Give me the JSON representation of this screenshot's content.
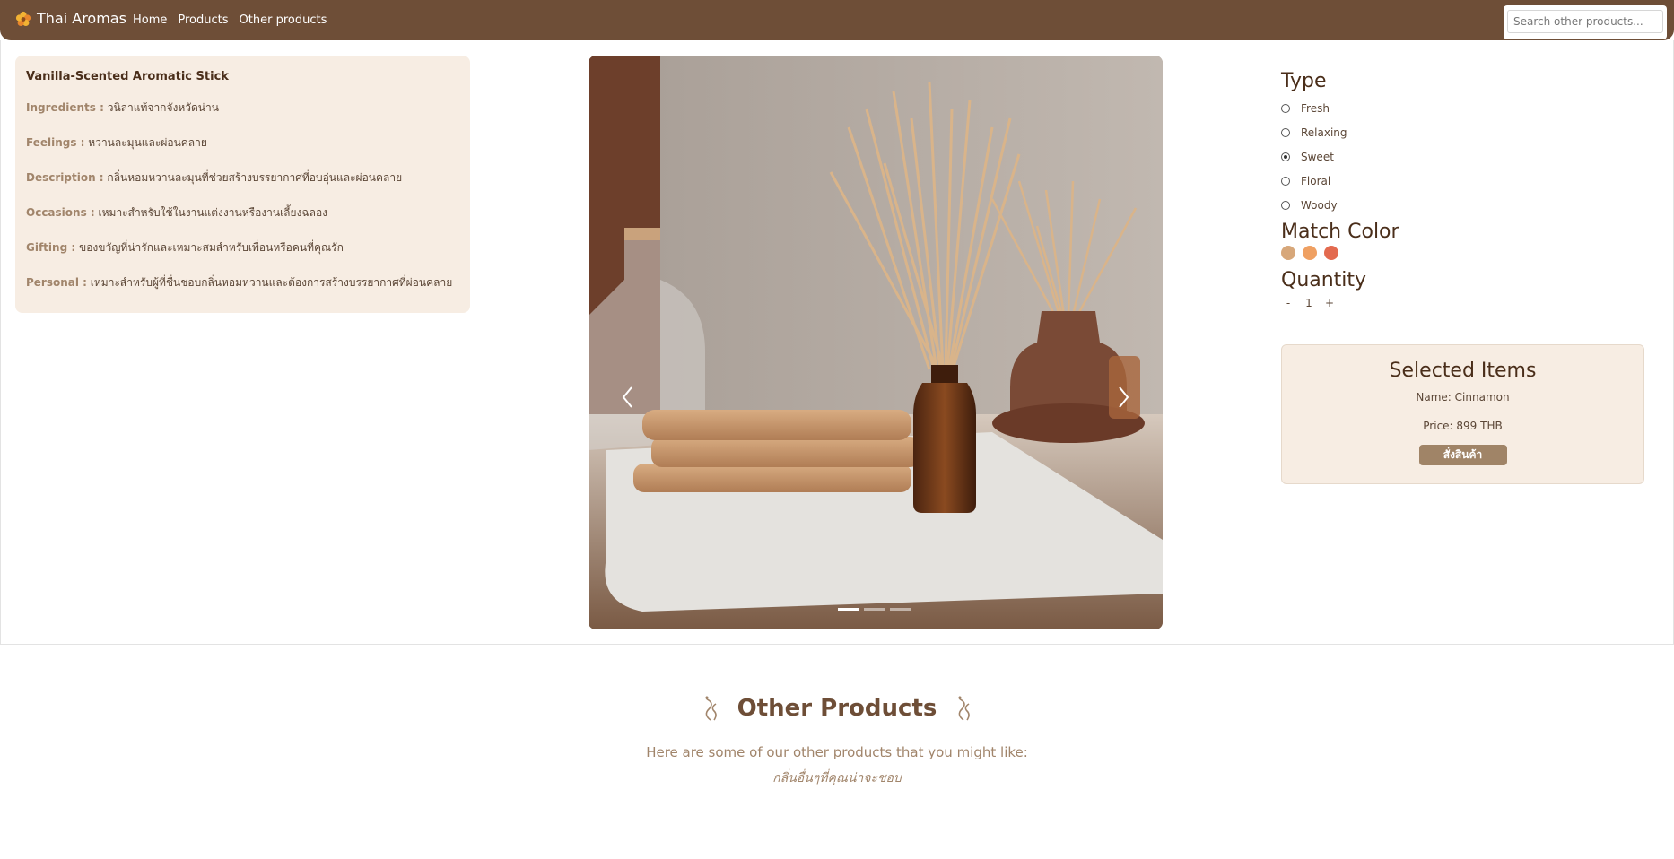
{
  "navbar": {
    "brand": "Thai Aromas",
    "brand_icon": "flower-icon",
    "links": [
      "Home",
      "Products",
      "Other products"
    ],
    "search_placeholder": "Search other products..."
  },
  "product_info": {
    "title": "Vanilla-Scented Aromatic Stick",
    "rows": [
      {
        "key": "Ingredients :",
        "value": "วนิลาแท้จากจังหวัดน่าน"
      },
      {
        "key": "Feelings :",
        "value": "หวานละมุนและผ่อนคลาย"
      },
      {
        "key": "Description :",
        "value": "กลิ่นหอมหวานละมุนที่ช่วยสร้างบรรยากาศที่อบอุ่นและผ่อนคลาย"
      },
      {
        "key": "Occasions :",
        "value": "เหมาะสำหรับใช้ในงานแต่งงานหรืองานเลี้ยงฉลอง"
      },
      {
        "key": "Gifting :",
        "value": "ของขวัญที่น่ารักและเหมาะสมสำหรับเพื่อนหรือคนที่คุณรัก"
      },
      {
        "key": "Personal :",
        "value": "เหมาะสำหรับผู้ที่ชื่นชอบกลิ่นหอมหวานและต้องการสร้างบรรยากาศที่ผ่อนคลาย"
      }
    ]
  },
  "carousel": {
    "slide_count": 3,
    "active_index": 0
  },
  "options": {
    "type_heading": "Type",
    "types": [
      {
        "label": "Fresh",
        "checked": false
      },
      {
        "label": "Relaxing",
        "checked": false
      },
      {
        "label": "Sweet",
        "checked": true
      },
      {
        "label": "Floral",
        "checked": false
      },
      {
        "label": "Woody",
        "checked": false
      }
    ],
    "color_heading": "Match Color",
    "colors": [
      "#d7a77a",
      "#efa062",
      "#e36a4f"
    ],
    "quantity_heading": "Quantity",
    "quantity": {
      "minus": "-",
      "value": "1",
      "plus": "+"
    }
  },
  "selected": {
    "title": "Selected Items",
    "name": "Name: Cinnamon",
    "price": "Price: 899 THB",
    "order_button": "สั่งสินค้า"
  },
  "other_products": {
    "title": "Other Products",
    "subtitle": "Here are some of our other products that you might like:",
    "thai_subtitle": "กลิ่นอื่นๆที่คุณน่าจะชอบ"
  }
}
